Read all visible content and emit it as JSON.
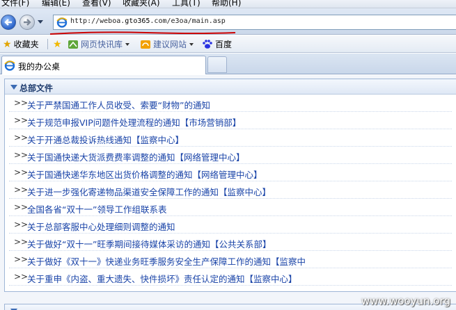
{
  "menu": [
    "文件(F)",
    "编辑(E)",
    "查看(V)",
    "收藏夹(A)",
    "工具(T)",
    "帮助(H)"
  ],
  "address": {
    "url_prefix": "http://weboa.",
    "url_domain": "gto365",
    "url_suffix": ".com/e3oa/main.asp"
  },
  "favorites": {
    "label": "收藏夹",
    "items": [
      {
        "label": "网页快讯库",
        "icon": "web-slice-icon"
      },
      {
        "label": "建议网站",
        "icon": "suggested-sites-icon"
      },
      {
        "label": "百度",
        "icon": "baidu-paw-icon"
      }
    ]
  },
  "tab": {
    "title": "我的办公桌"
  },
  "panel": {
    "title": "总部文件",
    "arrow": ">>",
    "items": [
      {
        "text": "关于严禁国通工作人员收受、索要“财物”的通知",
        "dept": ""
      },
      {
        "text": "关于规范申报VIP问题件处理流程的通知",
        "dept": "【市场营销部】"
      },
      {
        "text": "关于开通总裁投诉热线通知",
        "dept": "【监察中心】"
      },
      {
        "text": "关于国通快递大货派费费率调整的通知",
        "dept": "【网络管理中心】"
      },
      {
        "text": "关于国通快递华东地区出货价格调整的通知",
        "dept": "【网络管理中心】"
      },
      {
        "text": "关于进一步强化寄递物品渠道安全保障工作的通知",
        "dept": "【监察中心】"
      },
      {
        "text": "全国各省“双十一”领导工作组联系表",
        "dept": ""
      },
      {
        "text": "关于总部客服中心处理细则调整的通知",
        "dept": ""
      },
      {
        "text": "关于做好“双十一”旺季期间接待媒体采访的通知",
        "dept": "【公共关系部】"
      },
      {
        "text": "关于做好《双十一》快递业务旺季服务安全生产保障工作的通知",
        "dept": "【监察中"
      },
      {
        "text": "关于重申《内盗、重大遗失、快件损坏》责任认定的通知",
        "dept": "【监察中心】"
      }
    ]
  },
  "watermark": "www.wooyun.org",
  "colors": {
    "link": "#1a44a8",
    "panel_border": "#9fb6d6",
    "annotation": "#cc0000"
  }
}
